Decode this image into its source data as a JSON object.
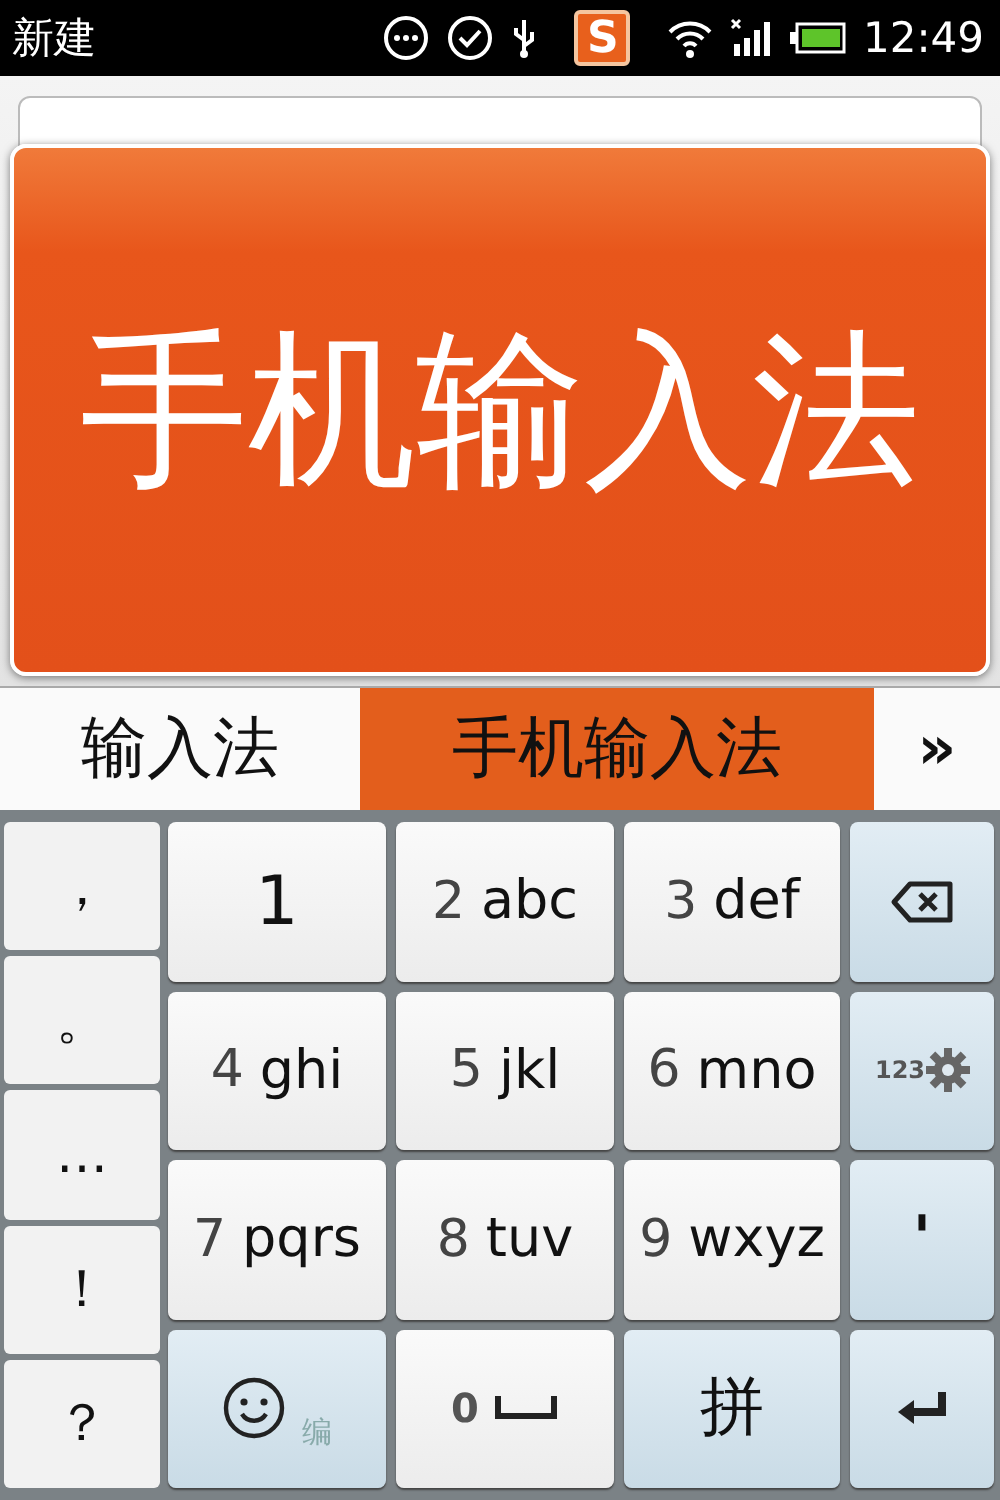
{
  "status_bar": {
    "title": "新建",
    "app_badge": "S",
    "time": "12:49"
  },
  "preview": {
    "text": "手机输入法"
  },
  "candidates": [
    {
      "text": "输入法",
      "selected": false
    },
    {
      "text": "手机输入法",
      "selected": true
    }
  ],
  "more_button": "»",
  "punctuation_keys": [
    "，",
    "。",
    "…",
    "！",
    "？"
  ],
  "keys": [
    {
      "kind": "digit",
      "digit": "1"
    },
    {
      "kind": "t9",
      "digit": "2",
      "letters": "abc"
    },
    {
      "kind": "t9",
      "digit": "3",
      "letters": "def"
    },
    {
      "kind": "delete"
    },
    {
      "kind": "t9",
      "digit": "4",
      "letters": "ghi"
    },
    {
      "kind": "t9",
      "digit": "5",
      "letters": "jkl"
    },
    {
      "kind": "t9",
      "digit": "6",
      "letters": "mno"
    },
    {
      "kind": "symbols",
      "label": "123"
    },
    {
      "kind": "t9",
      "digit": "7",
      "letters": "pqrs"
    },
    {
      "kind": "t9",
      "digit": "8",
      "letters": "tuv"
    },
    {
      "kind": "t9",
      "digit": "9",
      "letters": "wxyz"
    },
    {
      "kind": "apostrophe",
      "label": "'"
    },
    {
      "kind": "emoji",
      "label": "编"
    },
    {
      "kind": "space",
      "digit": "0"
    },
    {
      "kind": "pinyin",
      "label": "拼"
    },
    {
      "kind": "enter"
    }
  ]
}
